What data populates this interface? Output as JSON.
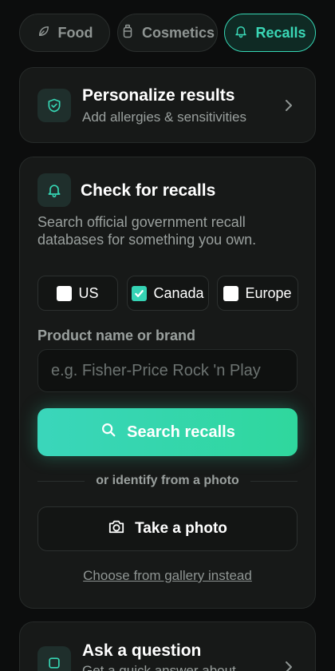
{
  "tabs": [
    {
      "label": "Food",
      "icon": "leaf-icon",
      "active": false
    },
    {
      "label": "Cosmetics",
      "icon": "bottle-icon",
      "active": false
    },
    {
      "label": "Recalls",
      "icon": "bell-icon",
      "active": true
    }
  ],
  "personalize": {
    "title": "Personalize results",
    "subtitle": "Add allergies & sensitivities",
    "icon": "shield-check-icon"
  },
  "check": {
    "title": "Check for recalls",
    "icon": "bell-icon",
    "description": "Search official government recall databases for something you own.",
    "regions": [
      {
        "label": "US",
        "checked": false
      },
      {
        "label": "Canada",
        "checked": true
      },
      {
        "label": "Europe",
        "checked": false
      }
    ],
    "field_label": "Product name or brand",
    "field_value": "",
    "field_placeholder": "e.g. Fisher-Price Rock 'n Play",
    "search_label": "Search recalls",
    "divider_text": "or identify from a photo",
    "photo_label": "Take a photo",
    "gallery_label": "Choose from gallery instead"
  },
  "ask": {
    "title": "Ask a question",
    "subtitle": "Get a quick answer about"
  },
  "colors": {
    "accent": "#36d6b4",
    "background": "#0c0d0d",
    "card": "#171918"
  }
}
